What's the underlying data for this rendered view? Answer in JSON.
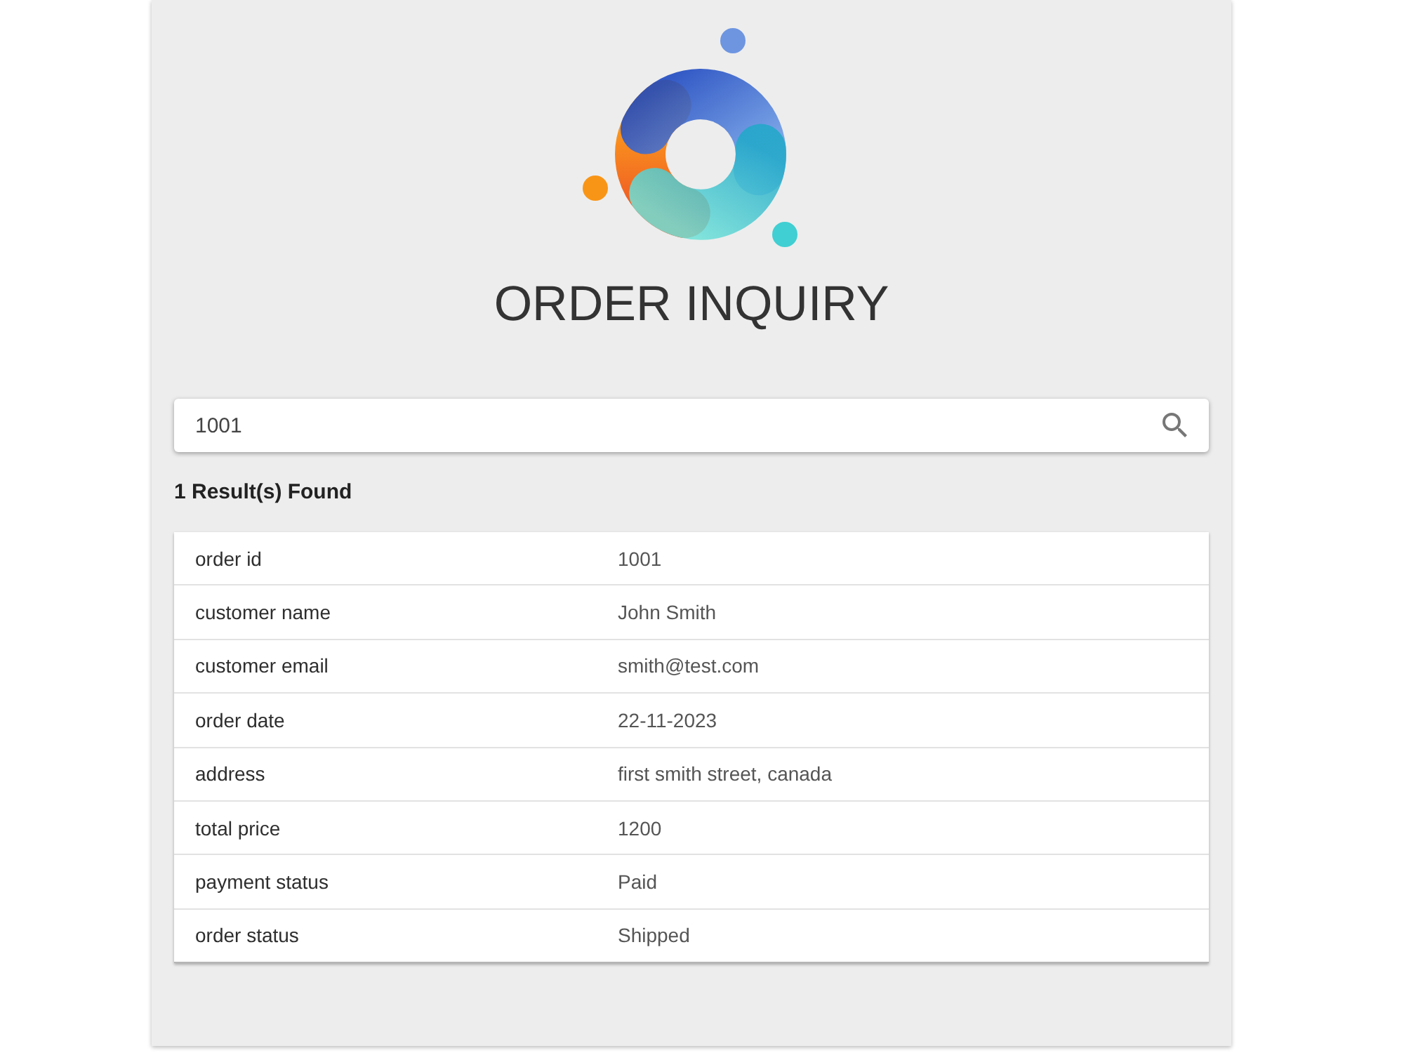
{
  "title": "ORDER INQUIRY",
  "search": {
    "value": "1001"
  },
  "results": {
    "summary": "1 Result(s) Found"
  },
  "table": {
    "rows": [
      {
        "label": "order id",
        "value": "1001"
      },
      {
        "label": "customer name",
        "value": "John Smith"
      },
      {
        "label": "customer email",
        "value": "smith@test.com"
      },
      {
        "label": "order date",
        "value": "22-11-2023"
      },
      {
        "label": "address",
        "value": "first smith street, canada"
      },
      {
        "label": "total price",
        "value": "1200"
      },
      {
        "label": "payment status",
        "value": "Paid"
      },
      {
        "label": "order status",
        "value": "Shipped"
      }
    ]
  }
}
